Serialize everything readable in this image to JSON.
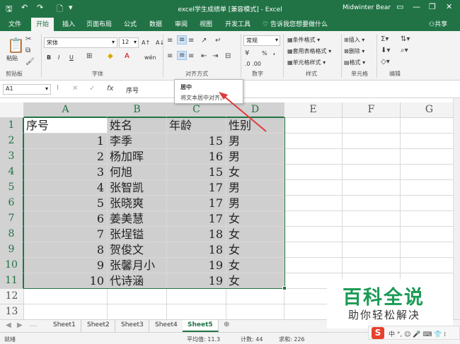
{
  "app": {
    "title": "excel学生成绩单 [兼容模式] - Excel",
    "user": "Midwinter Bear"
  },
  "quick_access": {
    "save": "🖫",
    "undo": "↶",
    "redo": "↷",
    "new": "🗋",
    "more": "▾"
  },
  "window_controls": {
    "ribbon_options": "▭",
    "minimize": "—",
    "restore": "❐",
    "close": "✕"
  },
  "tabs": [
    "文件",
    "开始",
    "插入",
    "页面布局",
    "公式",
    "数据",
    "审阅",
    "视图",
    "开发工具"
  ],
  "active_tab": "开始",
  "tell_me": "告诉我您想要做什么",
  "share": "共享",
  "ribbon": {
    "paste_label": "粘贴",
    "font_name": "宋体",
    "font_size": "12",
    "number_format": "常规",
    "bold": "B",
    "italic": "I",
    "underline": "U",
    "grow_font": "A↑",
    "shrink_font": "A↓",
    "wen": "wén",
    "percent": "%",
    "comma": ",",
    "cond_format": "条件格式 ▾",
    "table_format": "套用表格格式 ▾",
    "cell_styles": "单元格样式 ▾",
    "insert": "插入 ▾",
    "delete": "删除 ▾",
    "format": "格式 ▾",
    "groups": [
      "剪贴板",
      "字体",
      "对齐方式",
      "数字",
      "样式",
      "单元格",
      "编辑"
    ]
  },
  "tooltip": {
    "title": "居中",
    "desc": "将文本居中对齐。"
  },
  "formula_bar": {
    "name_box": "A1",
    "fx": "fx",
    "cancel": "✕",
    "enter": "✓",
    "content": "序号"
  },
  "columns": [
    "A",
    "B",
    "C",
    "D",
    "E",
    "F",
    "G"
  ],
  "rows": [
    "1",
    "2",
    "3",
    "4",
    "5",
    "6",
    "7",
    "8",
    "9",
    "10",
    "11",
    "12",
    "13"
  ],
  "table": {
    "header": [
      "序号",
      "姓名",
      "年龄",
      "性别"
    ],
    "data": [
      [
        "1",
        "李季",
        "15",
        "男"
      ],
      [
        "2",
        "杨加晖",
        "16",
        "男"
      ],
      [
        "3",
        "何旭",
        "15",
        "女"
      ],
      [
        "4",
        "张智凯",
        "17",
        "男"
      ],
      [
        "5",
        "张晓爽",
        "17",
        "男"
      ],
      [
        "6",
        "姜美慧",
        "17",
        "女"
      ],
      [
        "7",
        "张埕镒",
        "18",
        "女"
      ],
      [
        "8",
        "贺俊文",
        "18",
        "女"
      ],
      [
        "9",
        "张馨月小",
        "19",
        "女"
      ],
      [
        "10",
        "代诗涵",
        "19",
        "女"
      ]
    ]
  },
  "sheets": [
    "Sheet1",
    "Sheet2",
    "Sheet3",
    "Sheet4",
    "Sheet5"
  ],
  "active_sheet": "Sheet5",
  "status": {
    "mode": "就绪",
    "average": "平均值: 11.3",
    "count": "计数: 44",
    "sum": "求和: 226"
  },
  "watermark": {
    "title": "百科全说",
    "subtitle": "助你轻松解决"
  },
  "ime": {
    "logo": "S",
    "items": "中 °, ☺ 🎤 ⌨ 👕 ⁞"
  },
  "colors": {
    "excel_green": "#217346",
    "selection_gray": "#cfcfcf",
    "arrow_red": "#e03a3a",
    "watermark_green": "#1b9b55"
  }
}
